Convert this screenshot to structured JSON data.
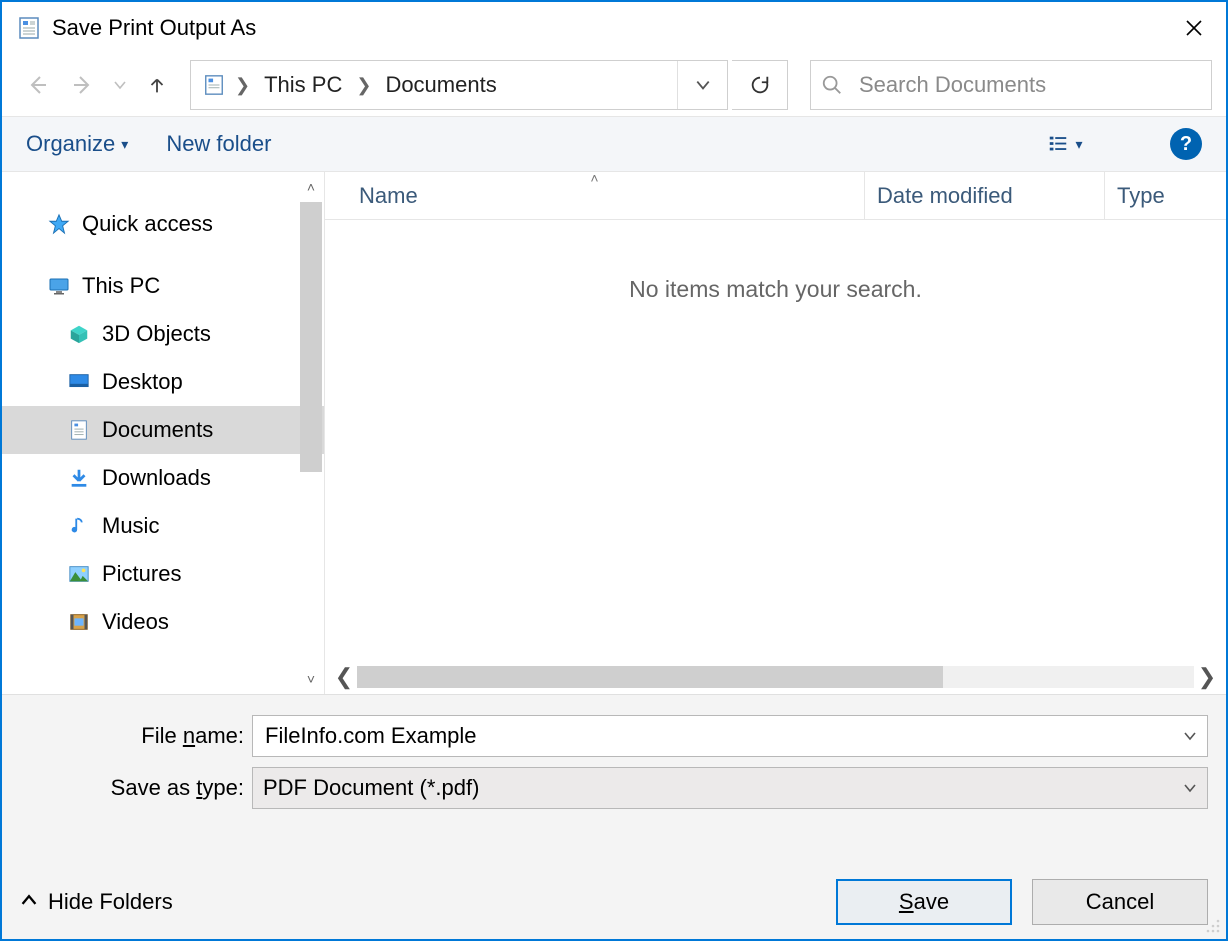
{
  "title": "Save Print Output As",
  "breadcrumb": {
    "pc": "This PC",
    "folder": "Documents"
  },
  "search": {
    "placeholder": "Search Documents"
  },
  "toolbar": {
    "organize": "Organize",
    "new_folder": "New folder"
  },
  "tree": {
    "quick_access": "Quick access",
    "this_pc": "This PC",
    "items": [
      "3D Objects",
      "Desktop",
      "Documents",
      "Downloads",
      "Music",
      "Pictures",
      "Videos"
    ],
    "selected_index": 2
  },
  "columns": {
    "name": "Name",
    "date": "Date modified",
    "type": "Type"
  },
  "empty_message": "No items match your search.",
  "form": {
    "filename_label_pre": "File ",
    "filename_label_u": "n",
    "filename_label_post": "ame:",
    "filename_value": "FileInfo.com Example",
    "type_label_pre": "Save as ",
    "type_label_u": "t",
    "type_label_post": "ype:",
    "type_value": "PDF Document (*.pdf)"
  },
  "footer": {
    "hide_folders": "Hide Folders",
    "save_u": "S",
    "save_rest": "ave",
    "cancel": "Cancel"
  }
}
